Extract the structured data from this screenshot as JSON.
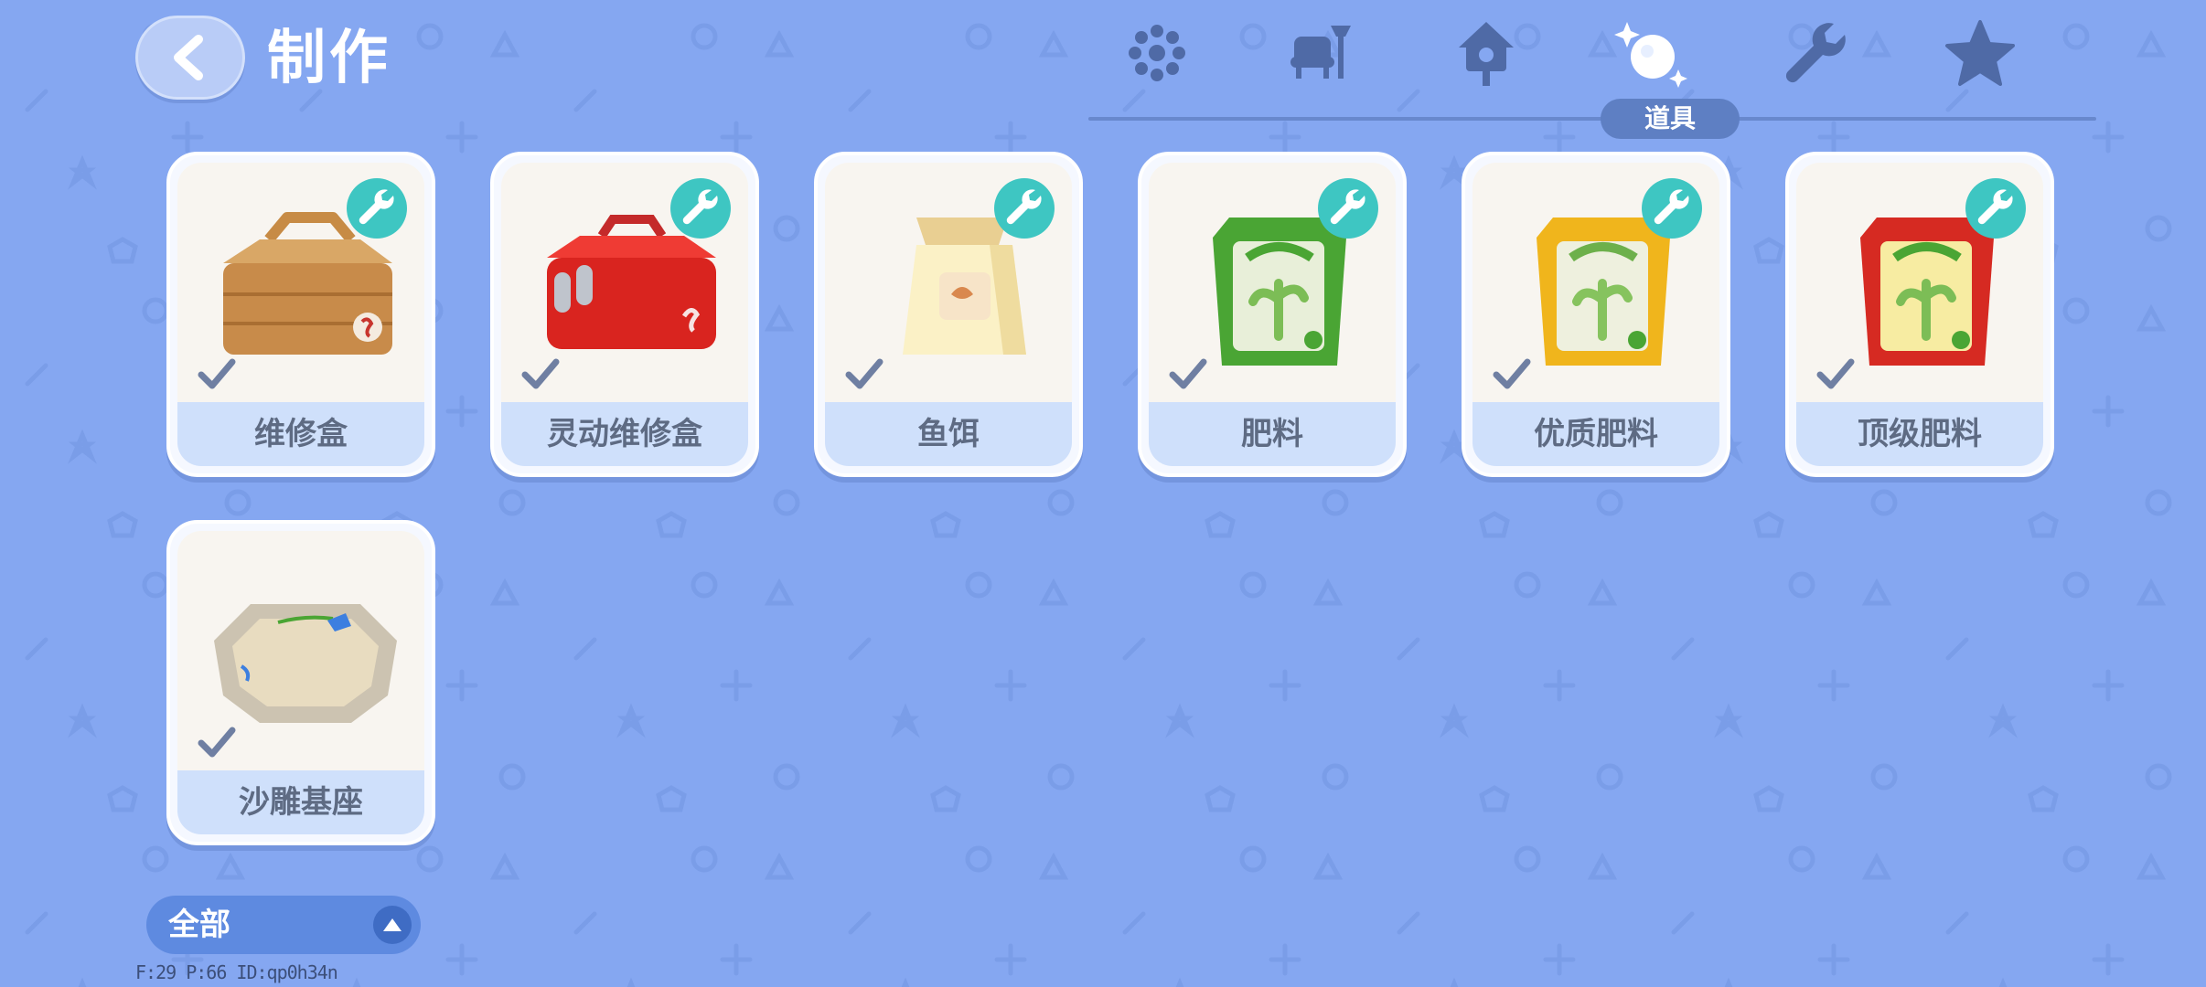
{
  "header": {
    "title": "制作"
  },
  "tabs": {
    "items": [
      {
        "icon": "dots-grid-icon"
      },
      {
        "icon": "furniture-icon"
      },
      {
        "icon": "birdhouse-icon"
      },
      {
        "icon": "sparkle-orb-icon",
        "label": "道具",
        "active": true
      },
      {
        "icon": "wrench-icon"
      },
      {
        "icon": "star-icon"
      }
    ]
  },
  "items": [
    {
      "name": "维修盒",
      "badge": "wrench-badge",
      "checked": true
    },
    {
      "name": "灵动维修盒",
      "badge": "wrench-badge",
      "checked": true
    },
    {
      "name": "鱼饵",
      "badge": "wrench-badge",
      "checked": true
    },
    {
      "name": "肥料",
      "badge": "wrench-badge",
      "checked": true
    },
    {
      "name": "优质肥料",
      "badge": "wrench-badge",
      "checked": true
    },
    {
      "name": "顶级肥料",
      "badge": "wrench-badge",
      "checked": true
    },
    {
      "name": "沙雕基座",
      "checked": true
    }
  ],
  "filter": {
    "label": "全部"
  },
  "debug": {
    "text": "F:29   P:66   ID:qp0h34n"
  },
  "colors": {
    "background": "#85a7f1",
    "badge": "#3ec6c2",
    "label_bg": "#cfe0fb",
    "tab_active_bg": "#5e7fc3"
  }
}
